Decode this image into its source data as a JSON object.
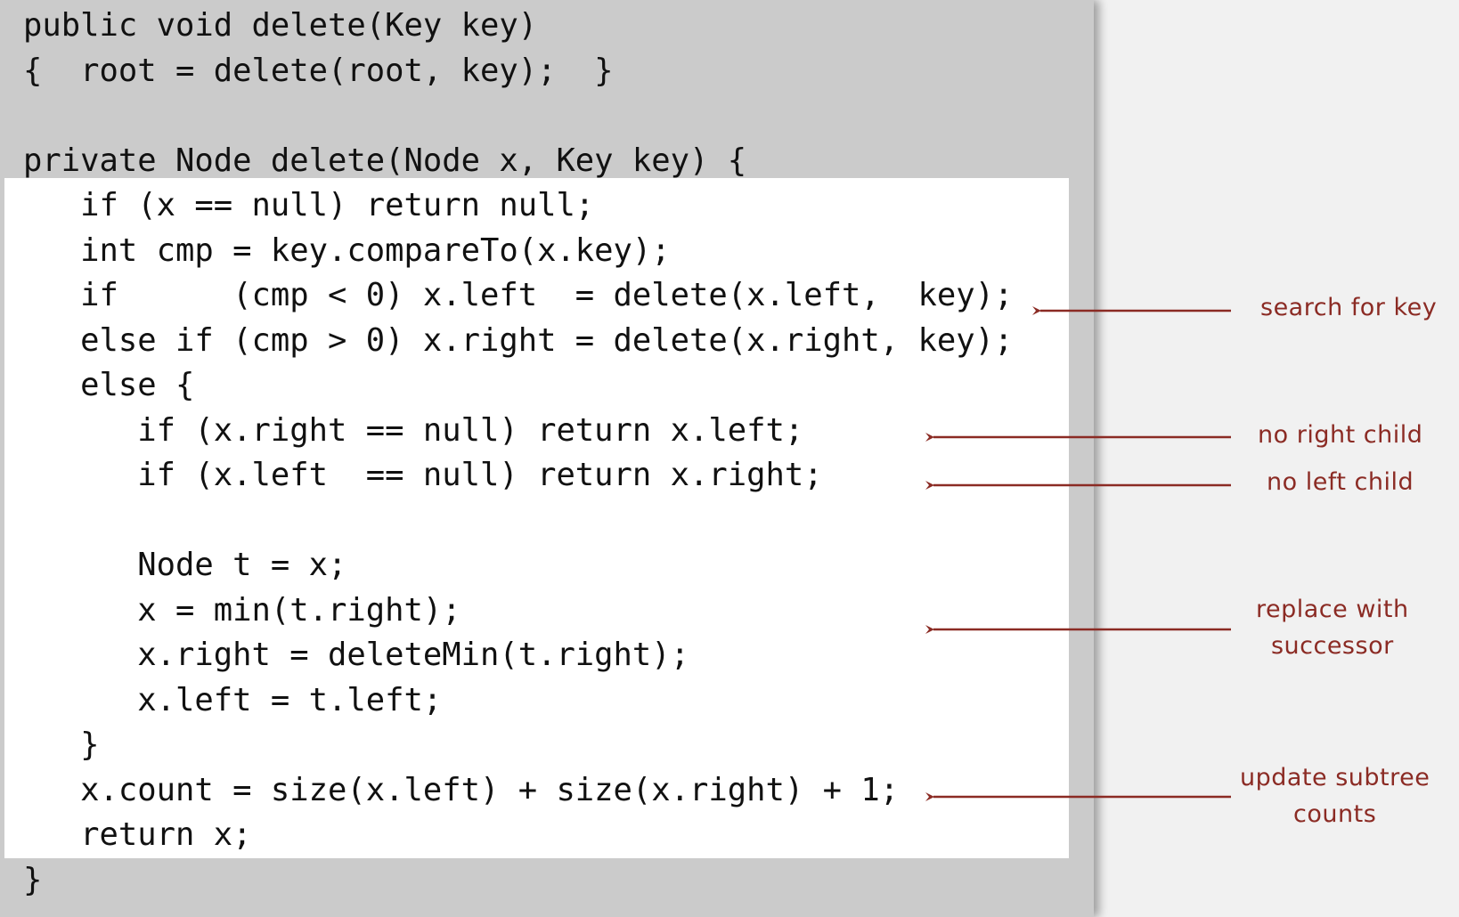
{
  "code_lines": [
    "public void delete(Key key)",
    "{  root = delete(root, key);  }",
    "",
    "private Node delete(Node x, Key key) {",
    "   if (x == null) return null;",
    "   int cmp = key.compareTo(x.key);",
    "   if      (cmp < 0) x.left  = delete(x.left,  key);",
    "   else if (cmp > 0) x.right = delete(x.right, key);",
    "   else {",
    "      if (x.right == null) return x.left;",
    "      if (x.left  == null) return x.right;",
    "",
    "      Node t = x;",
    "      x = min(t.right);",
    "      x.right = deleteMin(t.right);",
    "      x.left = t.left;",
    "   }",
    "   x.count = size(x.left) + size(x.right) + 1;",
    "   return x;",
    "}"
  ],
  "annotations": {
    "search": [
      "search for key"
    ],
    "no_right": [
      "no right child"
    ],
    "no_left": [
      "no left child"
    ],
    "successor": [
      "replace with",
      "successor"
    ],
    "counts": [
      "update subtree",
      "counts"
    ]
  },
  "colors": {
    "annotation": "#8b2b24",
    "panel_background": "#cbcbcb",
    "highlight_background": "#ffffff",
    "page_background": "#f1f1f1"
  }
}
